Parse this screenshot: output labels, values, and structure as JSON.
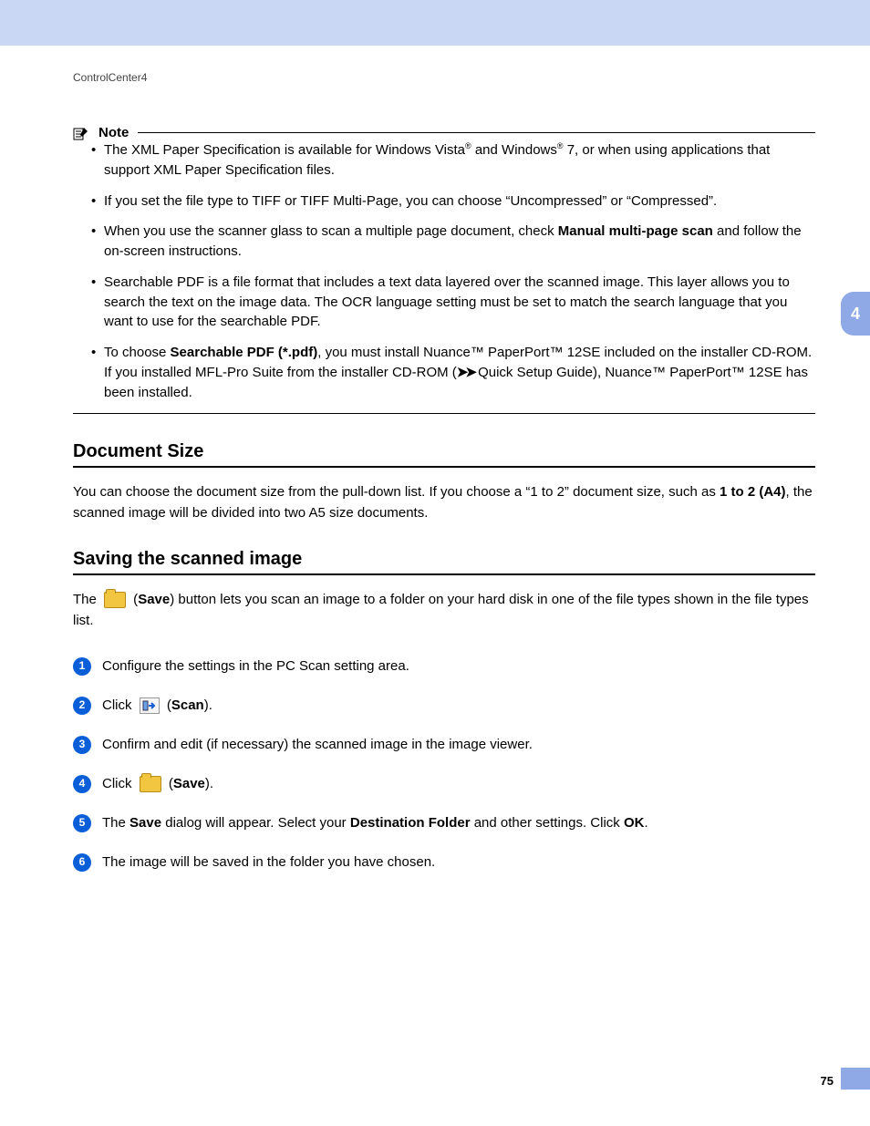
{
  "runningHead": "ControlCenter4",
  "sideTab": "4",
  "pageNumber": "75",
  "note": {
    "label": "Note",
    "items": [
      {
        "pre": "The XML Paper Specification is available for Windows Vista",
        "sup1": "®",
        "mid": " and Windows",
        "sup2": "®",
        "post": " 7, or when using applications that support XML Paper Specification files."
      },
      {
        "text": "If you set the file type to TIFF or TIFF Multi-Page, you can choose “Uncompressed” or “Compressed”."
      },
      {
        "pre": "When you use the scanner glass to scan a multiple page document, check ",
        "bold": "Manual multi-page scan",
        "post": " and follow the on-screen instructions."
      },
      {
        "text": "Searchable PDF is a file format that includes a text data layered over the scanned image. This layer allows you to search the text on the image data. The OCR language setting must be set to match the search language that you want to use for the searchable PDF."
      },
      {
        "pre": "To choose ",
        "bold": "Searchable PDF (*.pdf)",
        "post1": ", you must install  Nuance™ PaperPort™ 12SE included on the installer CD-ROM. If you installed MFL-Pro Suite from the installer CD-ROM (",
        "arrows": "➤➤",
        "post2": " Quick Setup Guide), Nuance™ PaperPort™ 12SE has been installed."
      }
    ]
  },
  "sections": {
    "docSize": {
      "heading": "Document Size",
      "p_pre": "You can choose the document size from the pull-down list. If you choose a “1 to 2” document size, such as ",
      "p_bold": "1 to 2 (A4)",
      "p_post": ", the scanned image will be divided into two A5 size documents."
    },
    "saving": {
      "heading": "Saving the scanned image",
      "intro_pre": "The ",
      "intro_save": "Save",
      "intro_post": ") button lets you scan an image to a folder on your hard disk in one of the file types shown in the file types list.",
      "steps": {
        "s1": "Configure the settings in the PC Scan setting area.",
        "s2_pre": "Click ",
        "s2_bold": "Scan",
        "s2_post": ").",
        "s3": "Confirm and edit (if necessary) the scanned image in the image viewer.",
        "s4_pre": "Click ",
        "s4_bold": "Save",
        "s4_post": ").",
        "s5_pre": "The ",
        "s5_b1": "Save",
        "s5_mid": " dialog will appear. Select your ",
        "s5_b2": "Destination Folder",
        "s5_mid2": " and other settings. Click ",
        "s5_b3": "OK",
        "s5_post": ".",
        "s6": "The image will be saved in the folder you have chosen."
      }
    }
  }
}
